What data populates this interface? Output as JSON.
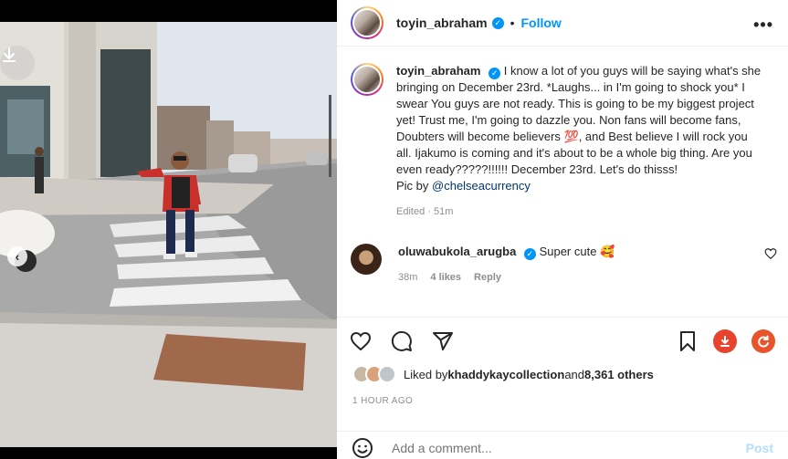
{
  "photo": {
    "carousel_dots": 2,
    "active_dot": 1
  },
  "header": {
    "username": "toyin_abraham",
    "separator": "•",
    "follow_label": "Follow",
    "more_label": "•••"
  },
  "caption": {
    "username": "toyin_abraham",
    "text": "I know a lot of you guys will be saying what's she bringing on December 23rd. *Laughs... in I'm going to shock you* I swear You guys are not ready. This is going to be my biggest project yet! Trust me, I'm going to dazzle you. Non fans will become fans, Doubters will become believers 💯, and Best believe I will rock you all. Ijakumo is coming and it's about to be a whole big thing. Are you even ready?????!!!!!! December 23rd. Let's do thisss!",
    "credit_prefix": "Pic by ",
    "credit_mention": "@chelseacurrency",
    "edited": "Edited",
    "meta_sep": " · ",
    "age": "51m"
  },
  "comment": {
    "username": "oluwabukola_arugba",
    "text": "Super cute 🥰",
    "time": "38m",
    "likes": "4 likes",
    "reply": "Reply"
  },
  "likes": {
    "prefix": "Liked by ",
    "user": "khaddykaycollection",
    "middle": " and ",
    "others": "8,361 others"
  },
  "timestamp": "1 HOUR AGO",
  "add_comment": {
    "placeholder": "Add a comment...",
    "post_label": "Post"
  },
  "colors": {
    "accent": "#0095f6",
    "ext_red": "#e8432d",
    "ext_orange": "#e8552d"
  }
}
